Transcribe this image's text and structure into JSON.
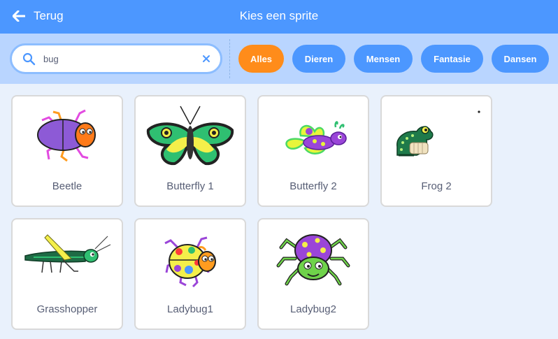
{
  "header": {
    "back_label": "Terug",
    "title": "Kies een sprite"
  },
  "search": {
    "value": "bug"
  },
  "tags": [
    {
      "label": "Alles",
      "active": true
    },
    {
      "label": "Dieren",
      "active": false
    },
    {
      "label": "Mensen",
      "active": false
    },
    {
      "label": "Fantasie",
      "active": false
    },
    {
      "label": "Dansen",
      "active": false
    }
  ],
  "sprites": [
    {
      "name": "Beetle",
      "icon": "beetle-icon"
    },
    {
      "name": "Butterfly 1",
      "icon": "butterfly-icon"
    },
    {
      "name": "Butterfly 2",
      "icon": "butterfly-icon"
    },
    {
      "name": "Frog 2",
      "icon": "frog-icon"
    },
    {
      "name": "Grasshopper",
      "icon": "grasshopper-icon"
    },
    {
      "name": "Ladybug1",
      "icon": "ladybug-icon"
    },
    {
      "name": "Ladybug2",
      "icon": "spider-bug-icon"
    }
  ],
  "colors": {
    "header": "#4c97ff",
    "filter_bar": "#b9d5ff",
    "active_tag": "#ff8c1a",
    "tag": "#4c97ff",
    "background": "#e9f1fc"
  }
}
